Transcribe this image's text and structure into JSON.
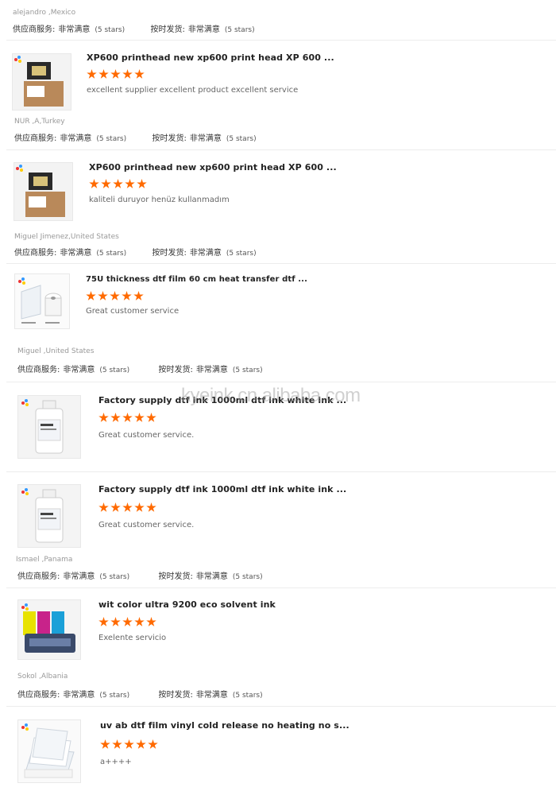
{
  "labels": {
    "supplier_service": "供应商服务:",
    "on_time_shipping": "按时发货:",
    "very_satisfied": "非常满意",
    "five_stars": "(5 stars)"
  },
  "watermark": "kyeink.cn.alibaba.com",
  "reviewers": [
    "alejandro ,Mexico",
    "NUR ,A,Turkey",
    "Miguel Jimenez,United States",
    "Miguel ,United States",
    "Ismael ,Panama",
    "Sokol ,Albania"
  ],
  "products": [
    {
      "title": "XP600 printhead new xp600 print head XP 600 ...",
      "rating": 5,
      "review": "excellent supplier excellent product excellent service",
      "image": "printhead-box"
    },
    {
      "title": "XP600 printhead new xp600 print head XP 600 ...",
      "rating": 5,
      "review": "kaliteli duruyor henüz kullanmadım",
      "image": "printhead-box"
    },
    {
      "title": "75U thickness dtf film 60 cm heat transfer dtf ...",
      "rating": 5,
      "review": "Great customer service",
      "image": "film-roll"
    },
    {
      "title": "Factory supply dtf ink 1000ml dtf ink white ink ...",
      "rating": 5,
      "review": "Great customer service.",
      "image": "ink-bottle"
    },
    {
      "title": "Factory supply dtf ink 1000ml dtf ink white ink ...",
      "rating": 5,
      "review": "Great customer service.",
      "image": "ink-bottle"
    },
    {
      "title": "wit color ultra 9200 eco solvent ink",
      "rating": 5,
      "review": "Exelente servicio",
      "image": "ink-bottles-set"
    },
    {
      "title": "uv ab dtf film vinyl cold release no heating no s...",
      "rating": 5,
      "review": "a++++",
      "image": "film-sheets"
    }
  ],
  "colors": {
    "star": "#ff6a00",
    "divider": "#ececec"
  }
}
